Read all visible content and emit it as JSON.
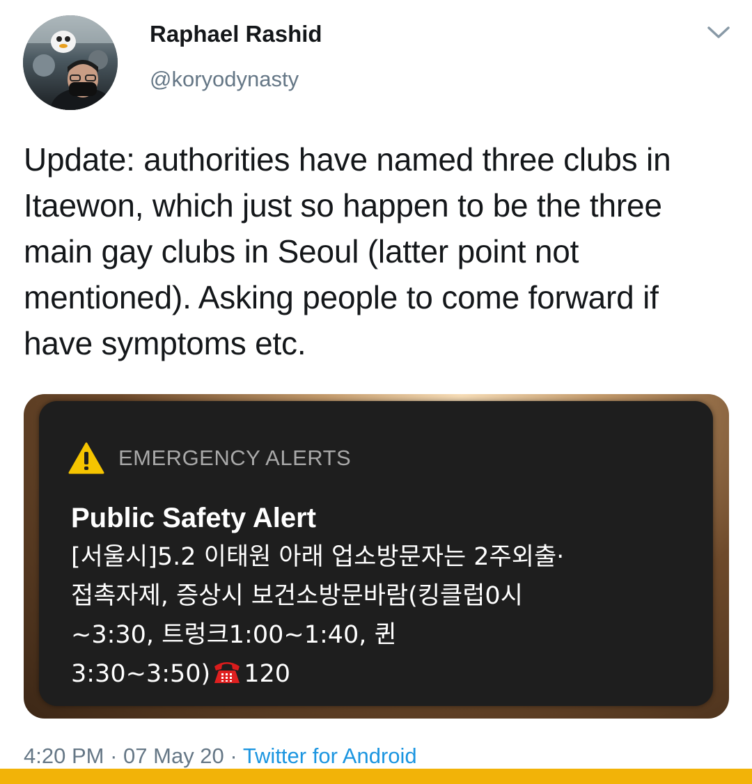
{
  "tweet": {
    "author": {
      "name": "Raphael Rashid",
      "handle": "@koryodynasty"
    },
    "text": "Update: authorities have named three clubs in Itaewon, which just so happen to be the three main gay clubs in Seoul (latter point not mentioned). Asking people to come forward if have symptoms etc.",
    "alert": {
      "header": "EMERGENCY ALERTS",
      "title": "Public Safety Alert",
      "lines": [
        "[서울시]5.2 이태원 아래 업소방문자는 2주외출·",
        "접촉자제, 증상시 보건소방문바람(킹클럽0시",
        "~3:30, 트렁크1:00~1:40, 퀸",
        "3:30~3:50)"
      ],
      "phone_number": "120"
    },
    "time": "4:20 PM",
    "date": "07 May 20",
    "source": "Twitter for Android",
    "separator": "·"
  },
  "colors": {
    "text_primary": "#14171a",
    "text_secondary": "#657786",
    "link": "#1b95e0",
    "alert_background": "#1e1e1e",
    "warning_yellow": "#f5c400",
    "bottom_bar": "#f2b308"
  },
  "icons": {
    "menu": "chevron-down-icon",
    "alert": "warning-icon",
    "phone": "telephone-icon"
  }
}
